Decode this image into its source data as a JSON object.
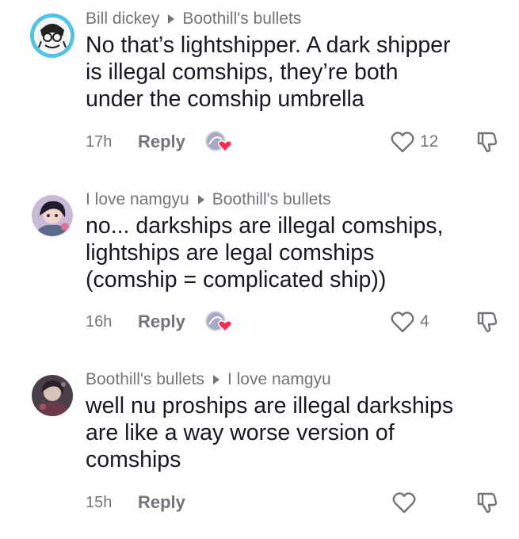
{
  "comments": [
    {
      "author": "Bill dickey",
      "reply_to": "Boothill's bullets",
      "lines": [
        "No that’s lightshipper. A dark shipper",
        "is illegal comships, they’re both",
        "under the comship umbrella"
      ],
      "time": "17h",
      "reply_label": "Reply",
      "like_count": "12",
      "creator_liked": true
    },
    {
      "author": "I love namgyu",
      "reply_to": "Boothill's bullets",
      "lines": [
        "no... darkships are illegal comships,",
        "lightships are legal comships",
        "(comship = complicated ship))"
      ],
      "time": "16h",
      "reply_label": "Reply",
      "like_count": "4",
      "creator_liked": true
    },
    {
      "author": "Boothill's bullets",
      "reply_to": "I love namgyu",
      "lines": [
        "well nu proships are illegal darkships",
        "are like a way worse version of",
        "comships"
      ],
      "time": "15h",
      "reply_label": "Reply",
      "like_count": "",
      "creator_liked": false
    }
  ],
  "colors": {
    "text": "#161823",
    "secondary": "#73737a",
    "heart": "#fe2c55",
    "avatar_ring": "#4fc3e8"
  },
  "icons": {
    "like": "heart-outline-icon",
    "dislike": "thumbs-down-outline-icon",
    "creator_like": "creator-liked-heart-icon"
  }
}
